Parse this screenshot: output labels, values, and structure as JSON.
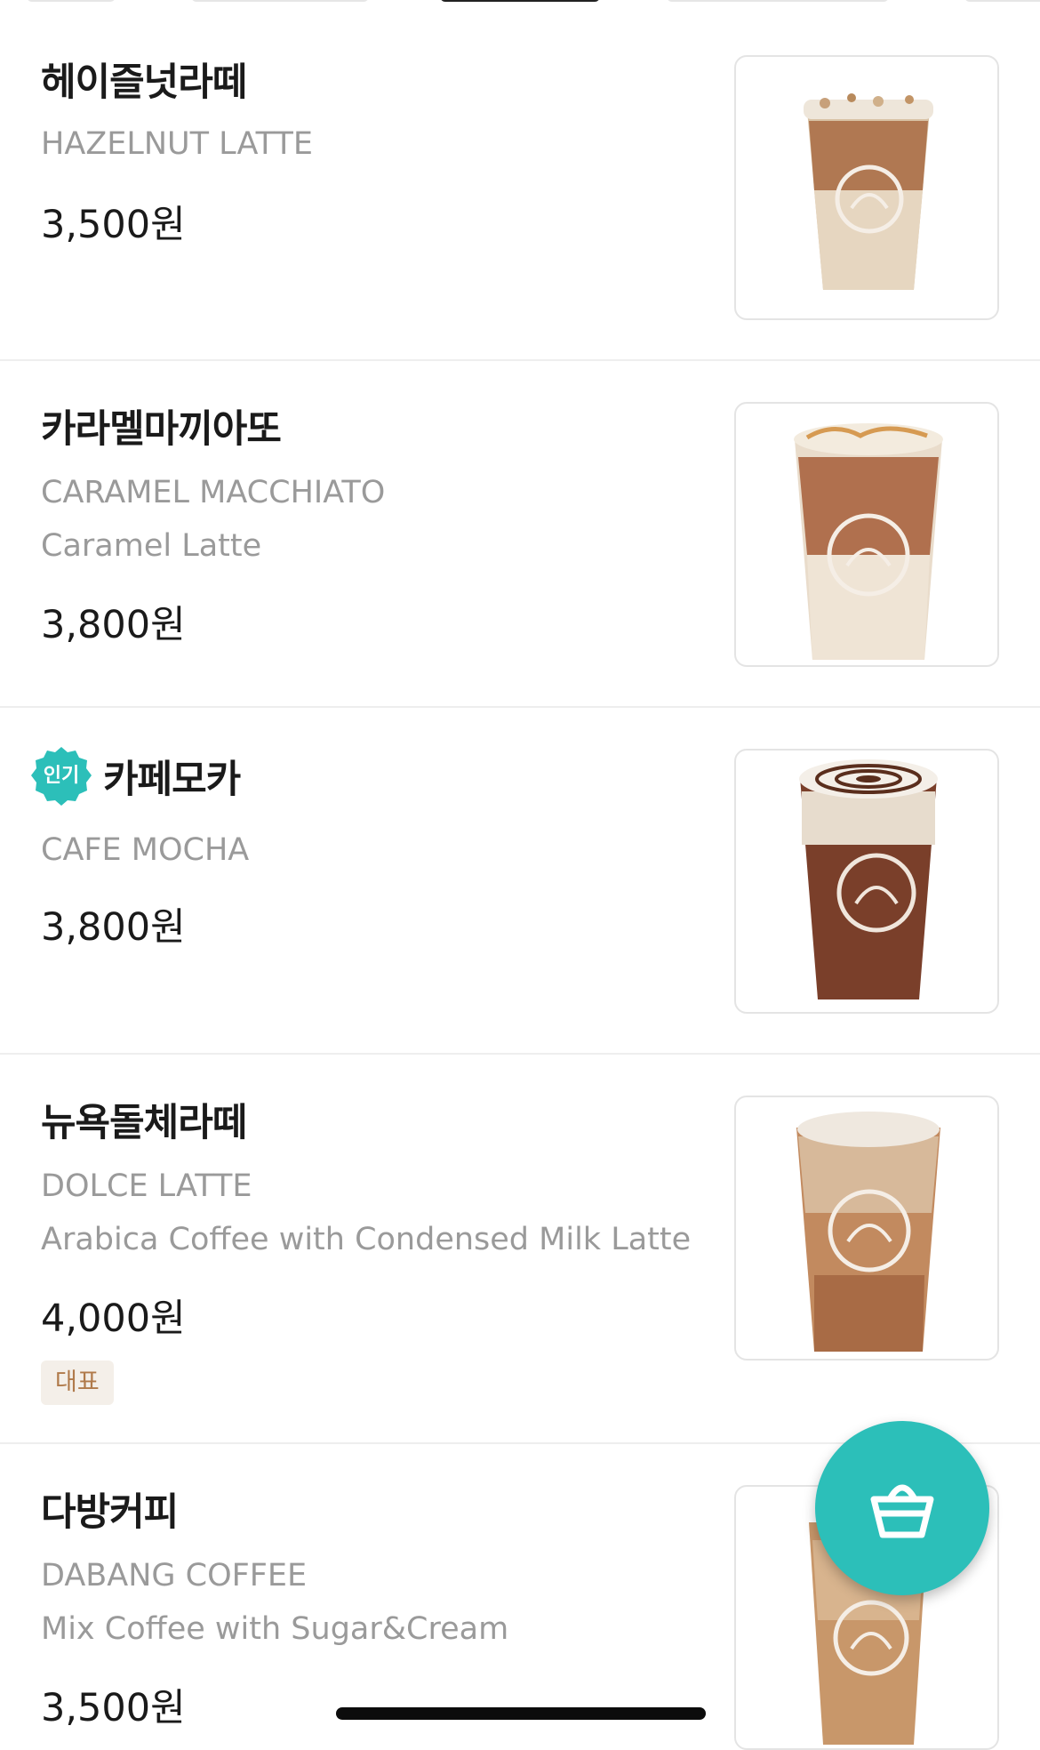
{
  "menu": {
    "items": [
      {
        "name": "헤이즐넛라떼",
        "name_en": "HAZELNUT LATTE",
        "description": "",
        "price": "3,500원"
      },
      {
        "name": "카라멜마끼아또",
        "name_en": "CARAMEL MACCHIATO",
        "description": "Caramel Latte",
        "price": "3,800원"
      },
      {
        "name": "카페모카",
        "name_en": "CAFE MOCHA",
        "description": "",
        "price": "3,800원",
        "badge": "인기"
      },
      {
        "name": "뉴욕돌체라떼",
        "name_en": "DOLCE LATTE",
        "description": "Arabica Coffee with Condensed Milk Latte",
        "price": "4,000원",
        "tag": "대표"
      },
      {
        "name": "다방커피",
        "name_en": "DABANG COFFEE",
        "description": "Mix Coffee with Sugar&Cream",
        "price": "3,500원"
      }
    ]
  },
  "cart_button": {
    "icon": "shopping-basket-icon"
  },
  "colors": {
    "accent": "#2cbfb9",
    "tag_bg": "#f4efe9",
    "tag_text": "#b07a4b",
    "subtext": "#9a9a9a"
  }
}
